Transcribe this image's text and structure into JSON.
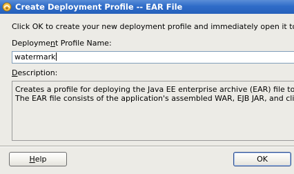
{
  "window": {
    "title": "Create Deployment Profile -- EAR File",
    "icon": "jdeveloper-app-icon"
  },
  "instruction": "Click OK to create your new deployment profile and immediately open it to see its con",
  "name_field": {
    "label_pre": "Deployme",
    "label_mnemonic": "n",
    "label_post": "t Profile Name:",
    "value": "watermark"
  },
  "description": {
    "label_mnemonic": "D",
    "label_post": "escription:",
    "lines": [
      "Creates a profile for deploying the Java EE enterprise archive (EAR) file to an applica",
      "The EAR file consists of the application's assembled WAR, EJB JAR, and client JAR fil"
    ]
  },
  "buttons": {
    "help_mnemonic": "H",
    "help_rest": "elp",
    "ok": "OK"
  },
  "colors": {
    "titlebar": "#2f6cc8",
    "dialog_bg": "#ecebe6",
    "input_border": "#7f9db9"
  }
}
